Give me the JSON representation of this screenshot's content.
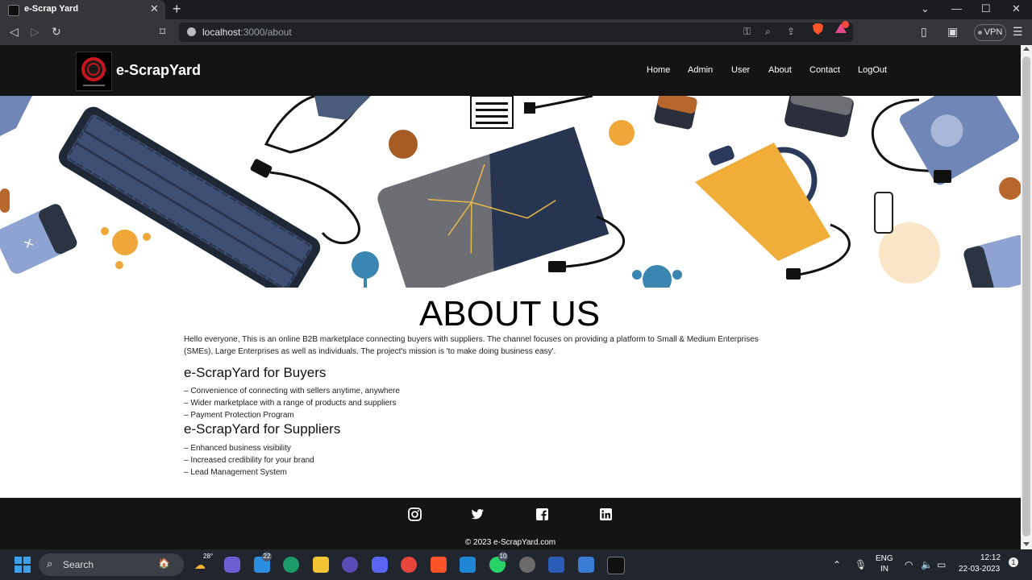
{
  "browser": {
    "tab_title": "e-Scrap Yard",
    "url_host": "localhost",
    "url_path": ":3000/about",
    "vpn_label": "VPN"
  },
  "site": {
    "brand": "e-ScrapYard",
    "nav": [
      "Home",
      "Admin",
      "User",
      "About",
      "Contact",
      "LogOut"
    ],
    "about_title": "ABOUT US",
    "intro": "Hello everyone, This is an online B2B marketplace connecting buyers with suppliers. The channel focuses on providing a platform to Small & Medium Enterprises (SMEs), Large Enterprises as well as individuals. The project's mission is 'to make doing business easy'.",
    "buyers_heading": "e-ScrapYard for Buyers",
    "buyers_points": [
      "– Convenience of connecting with sellers anytime, anywhere",
      "– Wider marketplace with a range of products and suppliers",
      "– Payment Protection Program"
    ],
    "suppliers_heading": "e-ScrapYard for Suppliers",
    "suppliers_points": [
      "– Enhanced business visibility",
      "– Increased credibility for your brand",
      "– Lead Management System"
    ],
    "copyright": "© 2023 e-ScrapYard.com",
    "social_icons": [
      "instagram-icon",
      "twitter-icon",
      "facebook-icon",
      "linkedin-icon"
    ]
  },
  "taskbar": {
    "search_label": "Search",
    "weather_temp": "28°",
    "mail_badge": "22",
    "whatsapp_badge": "10",
    "language_line1": "ENG",
    "language_line2": "IN",
    "time": "12:12",
    "date": "22-03-2023"
  },
  "colors": {
    "nav_bg": "#141414",
    "footer_bg": "#141414",
    "chrome_bg": "#35363a",
    "tabbar_bg": "#1c1d22"
  }
}
